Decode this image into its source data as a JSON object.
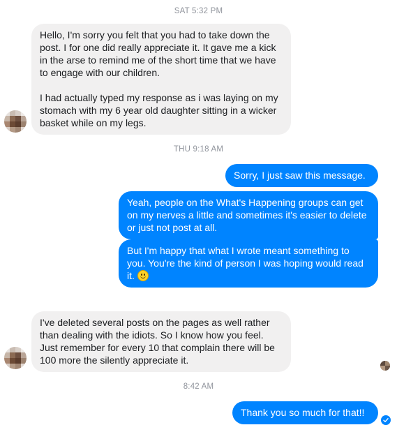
{
  "conversation": {
    "timestamps": [
      "SAT 5:32 PM",
      "THU 9:18 AM",
      "8:42 AM"
    ],
    "messages": [
      {
        "from": "them",
        "paragraphs": [
          "Hello, I'm sorry you felt that you had to take down the post. I for one did really appreciate it. It gave me a kick in the arse to remind me of the short time that we have to engage with our children.",
          "I had actually typed my response as i was laying on my stomach with my 6 year old daughter sitting in a wicker basket while on my legs."
        ]
      },
      {
        "from": "me",
        "text": "Sorry, I just saw this message."
      },
      {
        "from": "me",
        "text": "Yeah, people on the What's Happening groups can get on my nerves a little and sometimes it's easier to delete or just not post at all."
      },
      {
        "from": "me",
        "text": "But I'm happy that what I wrote meant something to you. You're the kind of person I was hoping would read it.",
        "emoji": "smiley-emoji"
      },
      {
        "from": "them",
        "text": "I've deleted several posts on the pages as well rather than dealing with the idiots. So I know how you feel. Just remember for every 10 that complain there will be 100 more the silently appreciate it."
      },
      {
        "from": "me",
        "text": "Thank you so much for that!!"
      }
    ]
  },
  "indicators": {
    "seen_avatar": "seen-avatar-icon",
    "delivered": "delivered-check-icon"
  },
  "colors": {
    "outgoing_bubble": "#0084ff",
    "incoming_bubble": "#f1f0f0",
    "timestamp": "#90949c"
  }
}
